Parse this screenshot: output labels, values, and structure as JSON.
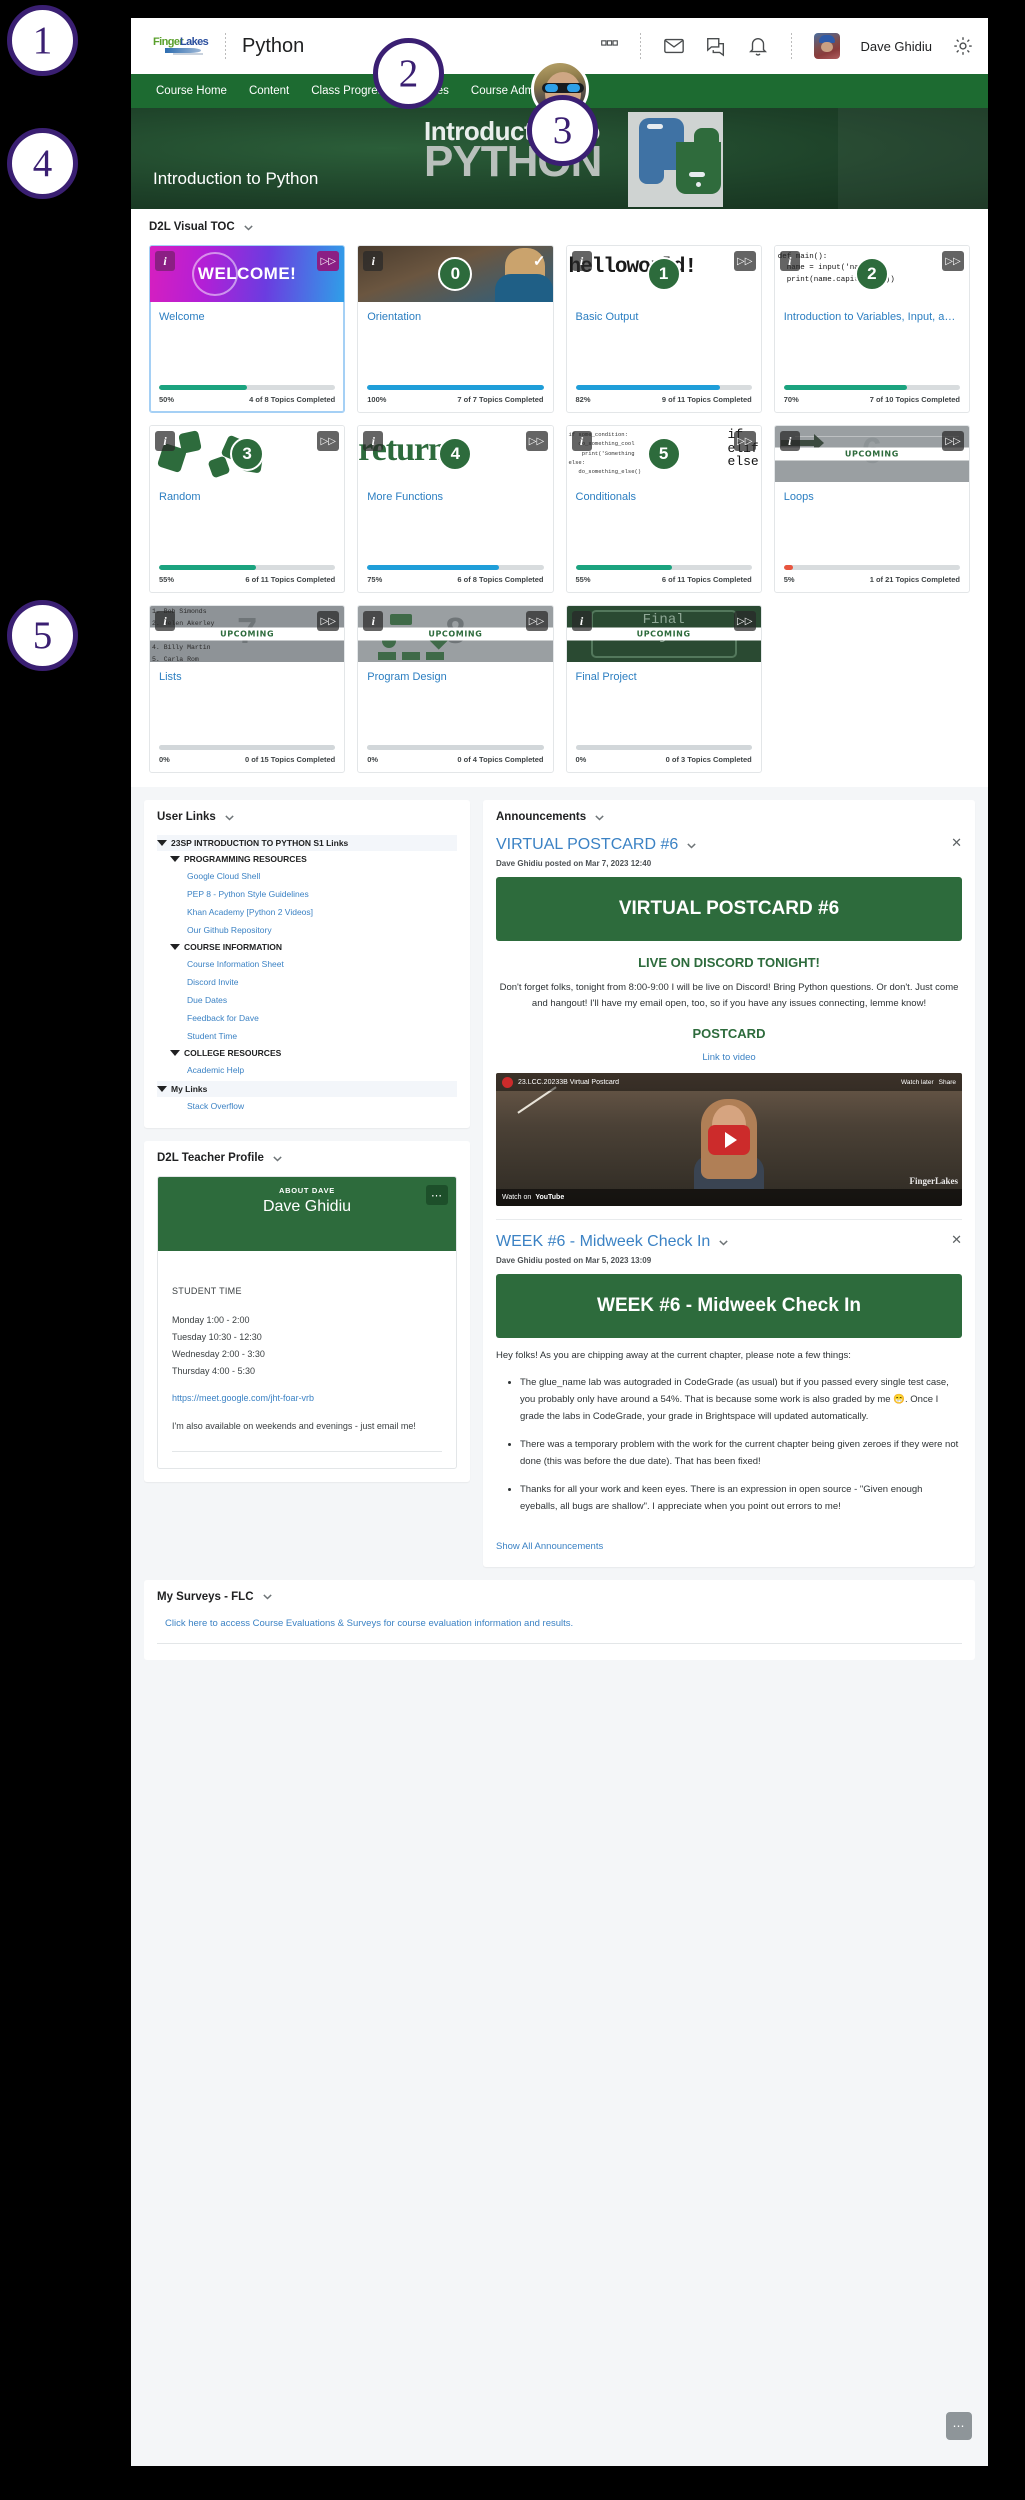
{
  "header": {
    "logo_part1": "Finger",
    "logo_part2": "Lakes",
    "course_title": "Python",
    "user_name": "Dave Ghidiu",
    "icons": [
      "apps-icon",
      "envelope-icon",
      "chat-icon",
      "bell-icon",
      "gear-icon"
    ]
  },
  "navbar": {
    "items": [
      {
        "label": "Course Home"
      },
      {
        "label": "Content"
      },
      {
        "label": "Class Progress"
      },
      {
        "label": "Grades"
      },
      {
        "label": "Course Admin"
      }
    ]
  },
  "banner": {
    "line1": "Introduction to",
    "line2": "PYTHON",
    "subtitle": "Introduction to Python"
  },
  "toc": {
    "widget_title": "D2L Visual TOC",
    "cards": [
      {
        "title": "Welcome",
        "badge": "",
        "percent": "50%",
        "topics": "4 of 8 Topics Completed",
        "fill": 50,
        "color": "#1ba37f",
        "thumb": "welcome",
        "thumb_text": "WELCOME!",
        "state": "selected",
        "corner": "fastforward"
      },
      {
        "title": "Orientation",
        "badge": "0",
        "percent": "100%",
        "topics": "7 of 7 Topics Completed",
        "fill": 100,
        "color": "#1f9ed9",
        "thumb": "orientation",
        "thumb_text": "",
        "state": "normal",
        "corner": "check"
      },
      {
        "title": "Basic Output",
        "badge": "1",
        "percent": "82%",
        "topics": "9 of 11 Topics Completed",
        "fill": 82,
        "color": "#1f9ed9",
        "thumb": "hello",
        "thumb_text": "helloworld!",
        "state": "normal",
        "corner": "fastforward"
      },
      {
        "title": "Introduction to Variables, Input, a…",
        "badge": "2",
        "percent": "70%",
        "topics": "7 of 10 Topics Completed",
        "fill": 70,
        "color": "#1ba37f",
        "thumb": "code",
        "thumb_text": "def main():\n  name = input('name? ')\n  print(name.capitalize())",
        "state": "normal",
        "corner": "fastforward"
      },
      {
        "title": "Random",
        "badge": "3",
        "percent": "55%",
        "topics": "6 of 11 Topics Completed",
        "fill": 55,
        "color": "#1ba37f",
        "thumb": "dice",
        "thumb_text": "",
        "state": "normal",
        "corner": "fastforward"
      },
      {
        "title": "More Functions",
        "badge": "4",
        "percent": "75%",
        "topics": "6 of 8 Topics Completed",
        "fill": 75,
        "color": "#1f9ed9",
        "thumb": "return",
        "thumb_text": "return",
        "state": "normal",
        "corner": "fastforward"
      },
      {
        "title": "Conditionals",
        "badge": "5",
        "percent": "55%",
        "topics": "6 of 11 Topics Completed",
        "fill": 55,
        "color": "#1ba37f",
        "thumb": "conditionals",
        "thumb_text": "if\nelif\nelse",
        "state": "normal",
        "corner": "fastforward"
      },
      {
        "title": "Loops",
        "badge": "6",
        "percent": "5%",
        "topics": "1 of 21 Topics Completed",
        "fill": 5,
        "color": "#e8553f",
        "thumb": "gray-arrow",
        "thumb_text": "UPCOMING",
        "state": "upcoming",
        "corner": "fastforward"
      },
      {
        "title": "Lists",
        "badge": "7",
        "percent": "0%",
        "topics": "0 of 15 Topics Completed",
        "fill": 0,
        "color": "#c7cdd0",
        "thumb": "names",
        "thumb_text": "UPCOMING",
        "state": "upcoming",
        "corner": "fastforward"
      },
      {
        "title": "Program Design",
        "badge": "8",
        "percent": "0%",
        "topics": "0 of 4 Topics Completed",
        "fill": 0,
        "color": "#c7cdd0",
        "thumb": "flow",
        "thumb_text": "UPCOMING",
        "state": "upcoming",
        "corner": "fastforward"
      },
      {
        "title": "Final Project",
        "badge": "",
        "percent": "0%",
        "topics": "0 of 3 Topics Completed",
        "fill": 0,
        "color": "#c7cdd0",
        "thumb": "final",
        "thumb_text": "UPCOMING",
        "state": "upcoming",
        "corner": "fastforward"
      }
    ]
  },
  "user_links": {
    "widget_title": "User Links",
    "groups": [
      {
        "level": 0,
        "label": "23SP INTRODUCTION TO PYTHON S1 Links"
      },
      {
        "level": 1,
        "label": "PROGRAMMING RESOURCES"
      },
      {
        "level": 2,
        "label": "Google Cloud Shell"
      },
      {
        "level": 2,
        "label": "PEP 8 - Python Style Guidelines"
      },
      {
        "level": 2,
        "label": "Khan Academy [Python 2 Videos]"
      },
      {
        "level": 2,
        "label": "Our Github Repository"
      },
      {
        "level": 1,
        "label": "COURSE INFORMATION"
      },
      {
        "level": 2,
        "label": "Course Information Sheet"
      },
      {
        "level": 2,
        "label": "Discord Invite"
      },
      {
        "level": 2,
        "label": "Due Dates"
      },
      {
        "level": 2,
        "label": "Feedback for Dave"
      },
      {
        "level": 2,
        "label": "Student Time"
      },
      {
        "level": 1,
        "label": "COLLEGE RESOURCES"
      },
      {
        "level": 2,
        "label": "Academic Help"
      },
      {
        "level": 0,
        "label": "My Links"
      },
      {
        "level": 2,
        "label": "Stack Overflow"
      }
    ]
  },
  "teacher_profile": {
    "widget_title": "D2L Teacher Profile",
    "about_label": "ABOUT DAVE",
    "name": "Dave Ghidiu",
    "menu_icon": "ellipsis-icon",
    "section_title": "STUDENT TIME",
    "hours": [
      "Monday 1:00 - 2:00",
      "Tuesday 10:30 - 12:30",
      "Wednesday 2:00 - 3:30",
      "Thursday 4:00 - 5:30"
    ],
    "meet_link": "https://meet.google.com/jht-foar-vrb",
    "note": "I'm also available on weekends and evenings - just email me!"
  },
  "announcements": {
    "widget_title": "Announcements",
    "show_all": "Show All Announcements",
    "items": [
      {
        "title": "VIRTUAL POSTCARD #6",
        "meta": "Dave Ghidiu posted on Mar 7, 2023 12:40",
        "hero": "VIRTUAL POSTCARD #6",
        "subhead": "LIVE ON DISCORD TONIGHT!",
        "body": "Don't forget folks, tonight from 8:00-9:00 I will be live on Discord! Bring Python questions. Or don't. Just come and hangout! I'll have my email open, too, so if you have any issues connecting, lemme know!",
        "postcard_label": "POSTCARD",
        "video_link": "Link to video",
        "video": {
          "title": "23.LCC.20233B Virtual Postcard",
          "watch_later": "Watch later",
          "share": "Share",
          "watch_on": "Watch on",
          "platform": "YouTube"
        }
      },
      {
        "title": "WEEK #6 - Midweek Check In",
        "meta": "Dave Ghidiu posted on Mar 5, 2023 13:09",
        "hero": "WEEK #6 - Midweek Check In",
        "intro": "Hey folks! As you are chipping away at the current chapter, please note a few things:",
        "bullets": [
          "The glue_name lab was autograded in CodeGrade (as usual) but if you passed every single test case, you probably only have around a 54%. That is because some work is also graded by me 😁. Once I grade the labs in CodeGrade, your grade in Brightspace will updated automatically.",
          "There was a temporary problem with the work for the current chapter being given zeroes if they were not done (this was before the due date). That has been fixed!",
          "Thanks for all your work and keen eyes. There is an expression in open source - \"Given enough eyeballs, all bugs are shallow\". I appreciate when you point out errors to me!"
        ]
      }
    ]
  },
  "surveys": {
    "widget_title": "My Surveys - FLC",
    "link": "Click here to access Course Evaluations & Surveys for course evaluation information and results."
  },
  "callouts": [
    {
      "number": "1"
    },
    {
      "number": "2"
    },
    {
      "number": "3"
    },
    {
      "number": "4"
    },
    {
      "number": "5"
    }
  ],
  "colors": {
    "brand_green": "#1d6b31",
    "profile_green": "#2d6b3c",
    "link_blue": "#3b82c4",
    "callout_purple": "#3a1f72"
  }
}
